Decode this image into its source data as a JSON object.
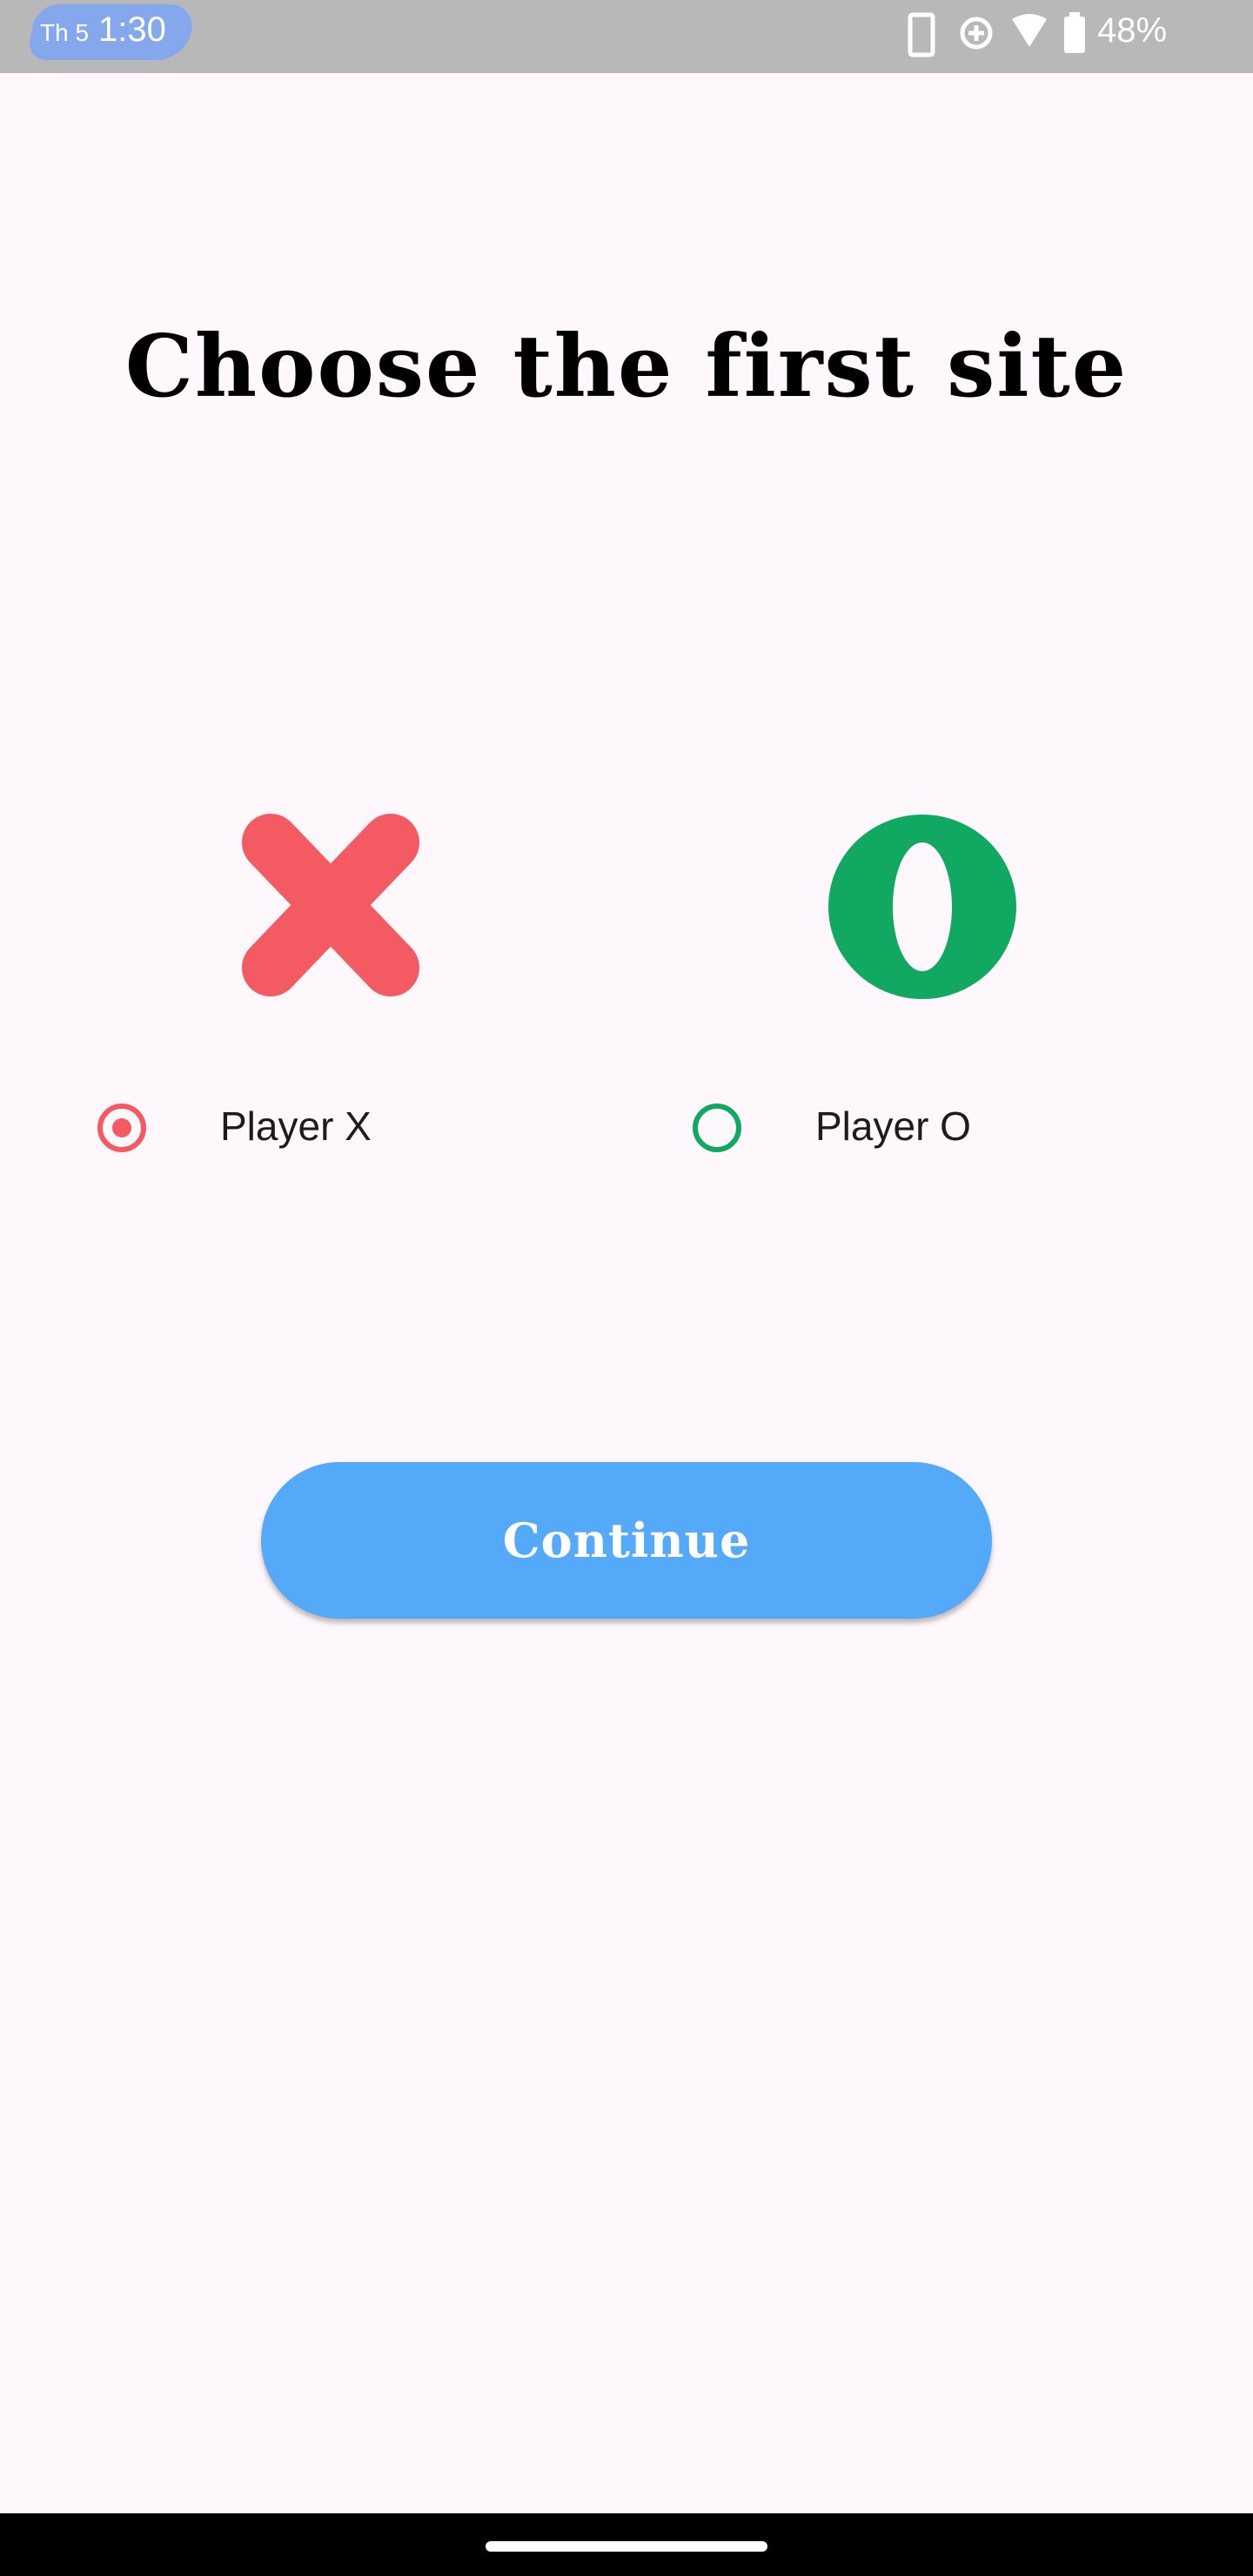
{
  "status_bar": {
    "day": "Th 5",
    "time": "1:30",
    "battery": "48%",
    "icons": [
      "phone-icon",
      "data-saver-icon",
      "wifi-icon",
      "battery-icon"
    ]
  },
  "title": "Choose the first site",
  "options": [
    {
      "mark": "x-mark-icon",
      "label": "Player X",
      "selected": true,
      "color": "#F45A61"
    },
    {
      "mark": "o-mark-icon",
      "label": "Player O",
      "selected": false,
      "color": "#11A862"
    }
  ],
  "continue_label": "Continue",
  "colors": {
    "background": "#FEF7FC",
    "accent_button": "#55A9F9",
    "player_x": "#F45A61",
    "player_o": "#11A862"
  }
}
